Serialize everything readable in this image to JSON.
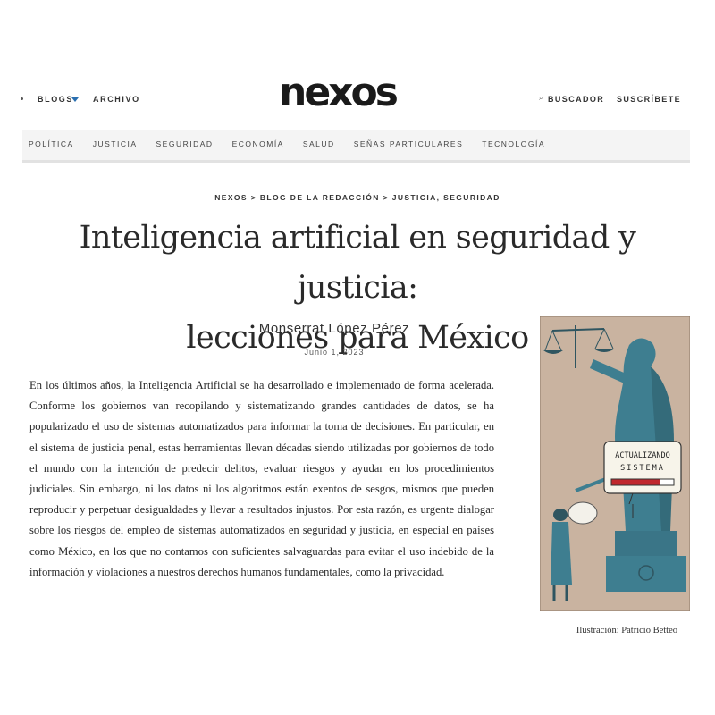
{
  "header": {
    "blogs_label": "BLOGS",
    "archivo_label": "ARCHIVO",
    "logo_text": "nexos",
    "search_icon": "search-icon",
    "buscador_label": "BUSCADOR",
    "suscribete_label": "SUSCRÍBETE",
    "accent_color": "#2a6fb0"
  },
  "categories": [
    "POLÍTICA",
    "JUSTICIA",
    "SEGURIDAD",
    "ECONOMÍA",
    "SALUD",
    "SEÑAS PARTICULARES",
    "TECNOLOGÍA"
  ],
  "article": {
    "breadcrumb": "NEXOS > BLOG DE LA REDACCIÓN > JUSTICIA, SEGURIDAD",
    "title_line1": "Inteligencia artificial en seguridad y justicia:",
    "title_line2": "lecciones para México",
    "author": "Monserrat López Pérez",
    "date": "Junio 1, 2023",
    "paragraph": "En los últimos años, la Inteligencia Artificial se ha desarrollado e implementado de forma acelerada. Conforme los gobiernos van recopilando y sistematizando grandes cantidades de datos, se ha popularizado el uso de sistemas automatizados para informar la toma de decisiones. En particular, en el sistema de justicia penal, estas herramientas llevan décadas siendo utilizadas por gobiernos de todo el mundo con la intención de predecir delitos, evaluar riesgos y ayudar en los procedimientos judiciales. Sin embargo, ni los datos ni los algoritmos están exentos de sesgos, mismos que pueden reproducir y perpetuar desigualdades y llevar a resultados injustos. Por esta razón, es urgente dialogar sobre los riesgos del empleo de sistemas automatizados en seguridad y justicia, en especial en países como México, en los que no contamos con suficientes salvaguardas para evitar el uso indebido de la información y violaciones a nuestros derechos humanos fundamentales, como la privacidad."
  },
  "illustration": {
    "sign_line1": "ACTUALIZANDO",
    "sign_line2": "SISTEMA",
    "progress": 0.78,
    "background_color": "#c9b3a0",
    "statue_color": "#3e7e90",
    "caption": "Ilustración: Patricio Betteo"
  }
}
